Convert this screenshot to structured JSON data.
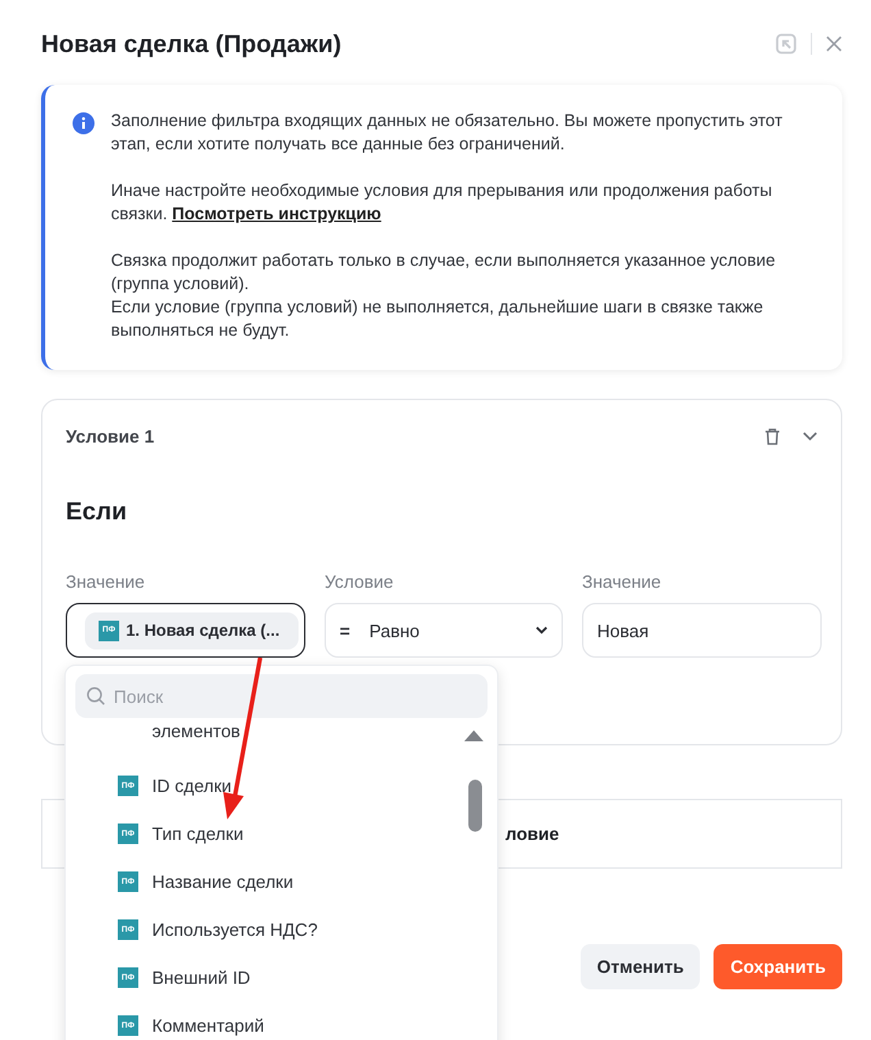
{
  "window": {
    "title": "Новая сделка (Продажи)"
  },
  "info": {
    "paragraphs": [
      {
        "text": "Заполнение фильтра входящих данных не обязательно. Вы можете пропустить этот этап, если хотите получать все данные без ограничений."
      },
      {
        "text": "Иначе настройте необходимые условия для прерывания или продолжения работы связки.",
        "link": "Посмотреть инструкцию"
      },
      {
        "text": "Связка продолжит работать только в случае, если выполняется указанное условие (группа условий).\nЕсли условие (группа условий) не выполняется, дальнейшие шаги в связке также выполняться не будут."
      }
    ]
  },
  "condition": {
    "title": "Условие 1",
    "if_label": "Если",
    "expanded": true,
    "fields": [
      {
        "kind": "chip",
        "label": "Значение",
        "badge": "ПФ",
        "value": "1. Новая сделка (...",
        "focused": true
      },
      {
        "kind": "select",
        "label": "Условие",
        "symbol": "=",
        "value": "Равно",
        "focused": false
      },
      {
        "kind": "text",
        "label": "Значение",
        "value": "Новая",
        "focused": false
      }
    ]
  },
  "add_condition": {
    "label": "ловие"
  },
  "dropdown": {
    "search": {
      "placeholder": "Поиск"
    },
    "items": [
      {
        "label": "элементов"
      },
      {
        "badge": "ПФ",
        "label": "ID сделки"
      },
      {
        "badge": "ПФ",
        "label": "Тип сделки"
      },
      {
        "badge": "ПФ",
        "label": "Название сделки"
      },
      {
        "badge": "ПФ",
        "label": "Используется НДС?"
      },
      {
        "badge": "ПФ",
        "label": "Внешний ID"
      },
      {
        "badge": "ПФ",
        "label": "Комментарий"
      }
    ]
  },
  "buttons": [
    {
      "label": "Отменить",
      "kind": "secondary"
    },
    {
      "label": "Сохранить",
      "kind": "primary"
    }
  ]
}
